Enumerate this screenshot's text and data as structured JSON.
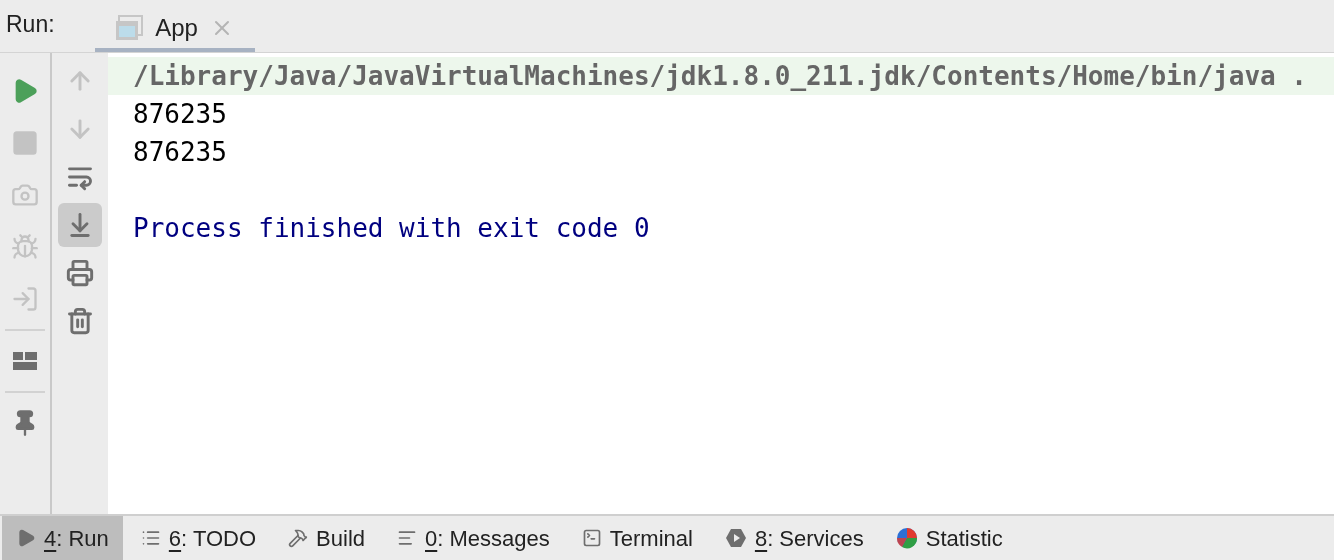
{
  "run_header": {
    "label": "Run:",
    "tabs": [
      {
        "label": "App",
        "selected": true
      }
    ]
  },
  "left_toolbar": [
    {
      "disabled": false
    },
    {
      "disabled": true
    },
    {
      "disabled": true
    },
    {
      "disabled": true
    },
    {
      "disabled": true
    },
    {
      "disabled": false
    },
    {
      "disabled": false
    }
  ],
  "console_toolbar": [
    {
      "disabled": true,
      "selected": false
    },
    {
      "disabled": true,
      "selected": false
    },
    {
      "disabled": false,
      "selected": false
    },
    {
      "disabled": false,
      "selected": true
    },
    {
      "disabled": false,
      "selected": false
    },
    {
      "disabled": false,
      "selected": false
    }
  ],
  "console_lines": [
    {
      "kind": "command",
      "text": "/Library/Java/JavaVirtualMachines/jdk1.8.0_211.jdk/Contents/Home/bin/java ."
    },
    {
      "kind": "output",
      "text": "876235"
    },
    {
      "kind": "output",
      "text": "876235"
    },
    {
      "kind": "blank"
    },
    {
      "kind": "exit",
      "text": "Process finished with exit code 0"
    }
  ],
  "bottom_tabs": [
    {
      "key": "4",
      "rest": ": Run",
      "selected": true
    },
    {
      "key": "6",
      "rest": ": TODO",
      "selected": false
    },
    {
      "rest": "Build",
      "selected": false
    },
    {
      "key": "0",
      "rest": ": Messages",
      "selected": false
    },
    {
      "rest": "Terminal",
      "selected": false
    },
    {
      "key": "8",
      "rest": ": Services",
      "selected": false
    },
    {
      "rest": "Statistic",
      "selected": false
    }
  ]
}
